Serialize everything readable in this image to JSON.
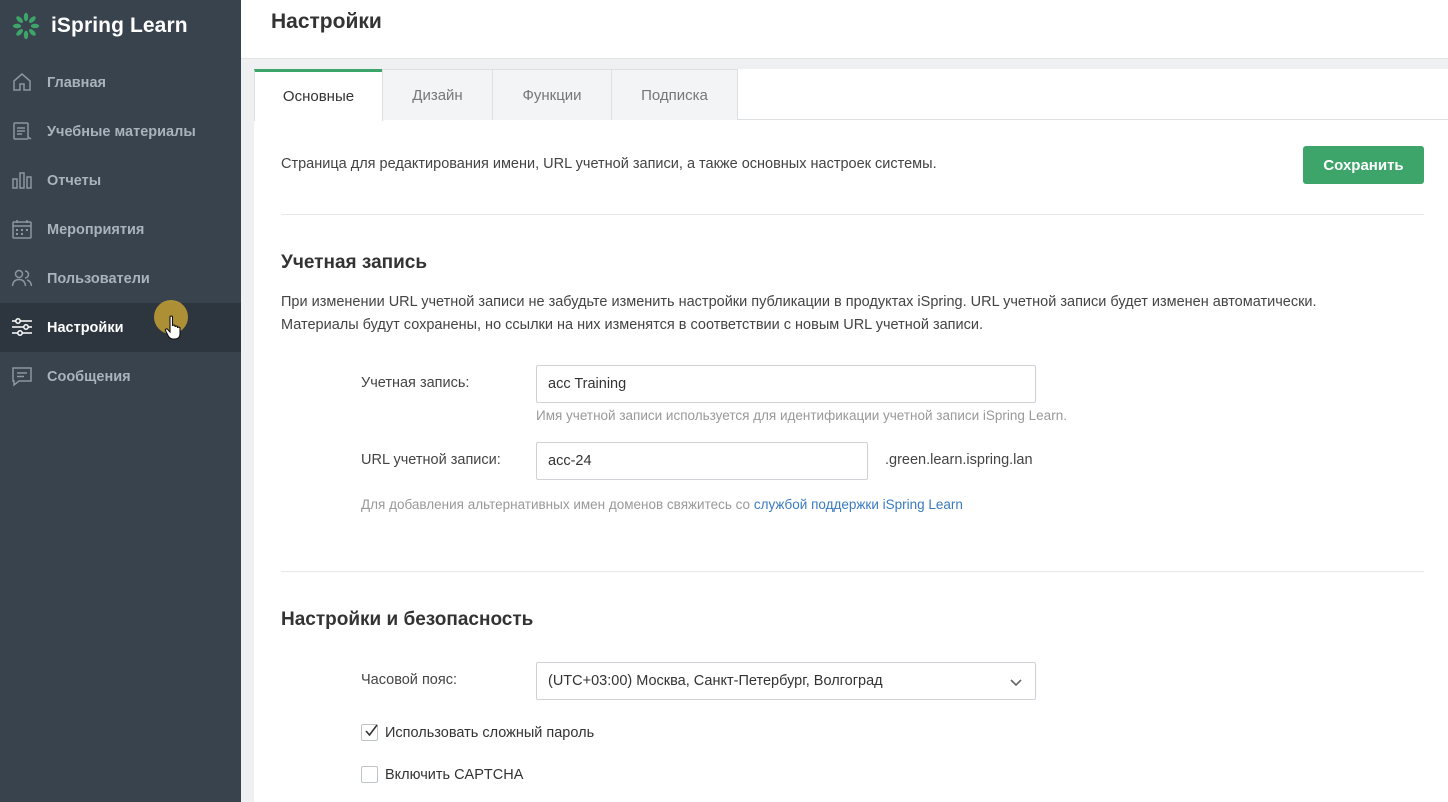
{
  "app": {
    "name": "iSpring Learn"
  },
  "sidebar": {
    "items": [
      {
        "label": "Главная",
        "icon": "home-icon"
      },
      {
        "label": "Учебные материалы",
        "icon": "book-icon"
      },
      {
        "label": "Отчеты",
        "icon": "bar-chart-icon"
      },
      {
        "label": "Мероприятия",
        "icon": "calendar-icon"
      },
      {
        "label": "Пользователи",
        "icon": "users-icon"
      },
      {
        "label": "Настройки",
        "icon": "sliders-icon",
        "active": true
      },
      {
        "label": "Сообщения",
        "icon": "message-icon"
      }
    ]
  },
  "header": {
    "title": "Настройки"
  },
  "tabs": [
    {
      "label": "Основные",
      "active": true
    },
    {
      "label": "Дизайн"
    },
    {
      "label": "Функции"
    },
    {
      "label": "Подписка"
    }
  ],
  "main": {
    "description": "Страница для редактирования имени, URL учетной записи, а также основных настроек системы.",
    "save_label": "Сохранить",
    "account": {
      "title": "Учетная запись",
      "text_line1": "При изменении URL учетной записи не забудьте изменить настройки публикации в продуктах iSpring. URL учетной записи будет изменен автоматически.",
      "text_line2": "Материалы будут сохранены, но ссылки на них изменятся в соответствии с новым URL учетной записи.",
      "name_label": "Учетная запись:",
      "name_value": "acc Training",
      "name_hint": "Имя учетной записи используется для идентификации учетной записи iSpring Learn.",
      "url_label": "URL учетной записи:",
      "url_value": "acc-24",
      "url_suffix": ".green.learn.ispring.lan",
      "domain_hint": "Для добавления альтернативных имен доменов свяжитесь со",
      "domain_link": "службой поддержки iSpring Learn"
    },
    "security": {
      "title": "Настройки и безопасность",
      "timezone_label": "Часовой пояс:",
      "timezone_value": "(UTC+03:00) Москва, Санкт-Петербург, Волгоград",
      "complex_password_label": "Использовать сложный пароль",
      "complex_password_checked": true,
      "captcha_label": "Включить CAPTCHA",
      "captcha_checked": false
    }
  },
  "colors": {
    "sidebar_bg": "#39434d",
    "accent": "#3ea56a",
    "link": "#3a7bc0"
  }
}
